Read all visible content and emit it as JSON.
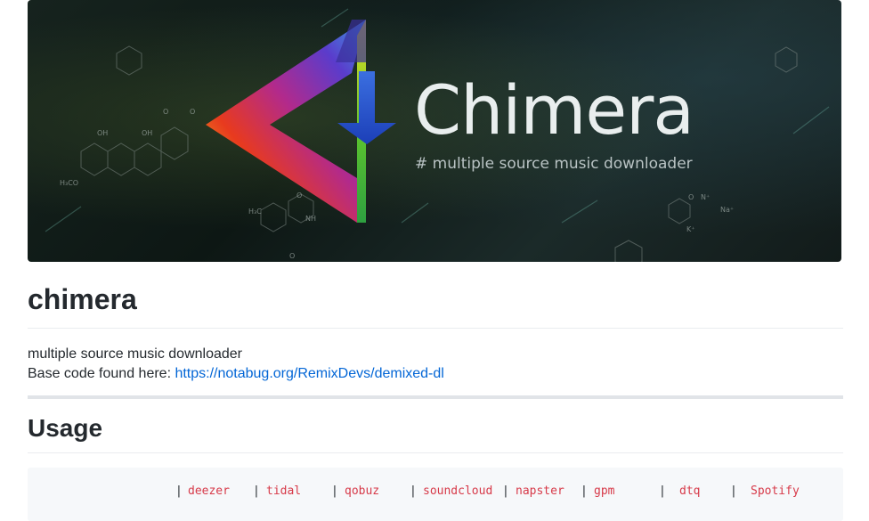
{
  "banner": {
    "title": "Chimera",
    "subtitle": "# multiple source music downloader"
  },
  "repo": {
    "name": "chimera",
    "description": "multiple source music downloader",
    "base_code_label": "Base code found here: ",
    "base_code_link": "https://notabug.org/RemixDevs/demixed-dl"
  },
  "usage": {
    "heading": "Usage",
    "separator": "|",
    "services": [
      "deezer",
      "tidal",
      "qobuz",
      "soundcloud",
      "napster",
      "gpm",
      "dtq",
      "Spotify"
    ]
  },
  "colors": {
    "link": "#0366d6",
    "code_keyword": "#d73a49",
    "code_background": "#f6f8fa"
  }
}
